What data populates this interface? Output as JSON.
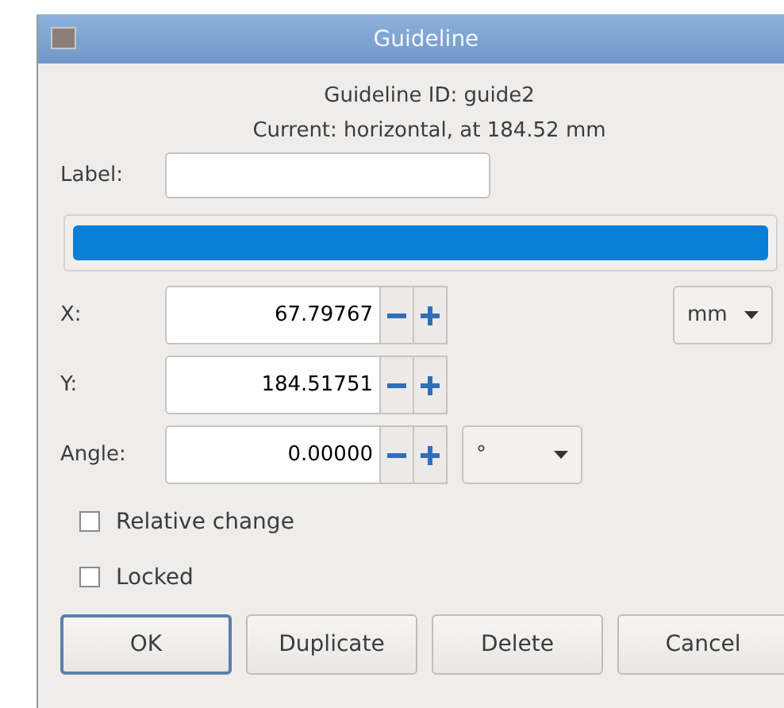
{
  "window": {
    "title": "Guideline"
  },
  "info": [
    "Guideline ID: guide2",
    "Current: horizontal, at 184.52 mm"
  ],
  "label_field": {
    "label": "Label:"
  },
  "color_button": {
    "color": "#0a7fd8"
  },
  "coords": [
    {
      "label": "X:",
      "value": "67.79767",
      "unit": "mm"
    },
    {
      "label": "Y:",
      "value": "184.51751"
    },
    {
      "label": "Angle:",
      "value": "0.00000",
      "unit": "°"
    }
  ],
  "checkboxes": [
    {
      "label": "Relative change",
      "checked": false
    },
    {
      "label": "Locked",
      "checked": false
    }
  ],
  "buttons": [
    {
      "label": "OK",
      "selected": true
    },
    {
      "label": "Duplicate",
      "selected": false
    },
    {
      "label": "Delete",
      "selected": false
    },
    {
      "label": "Cancel",
      "selected": false
    }
  ]
}
